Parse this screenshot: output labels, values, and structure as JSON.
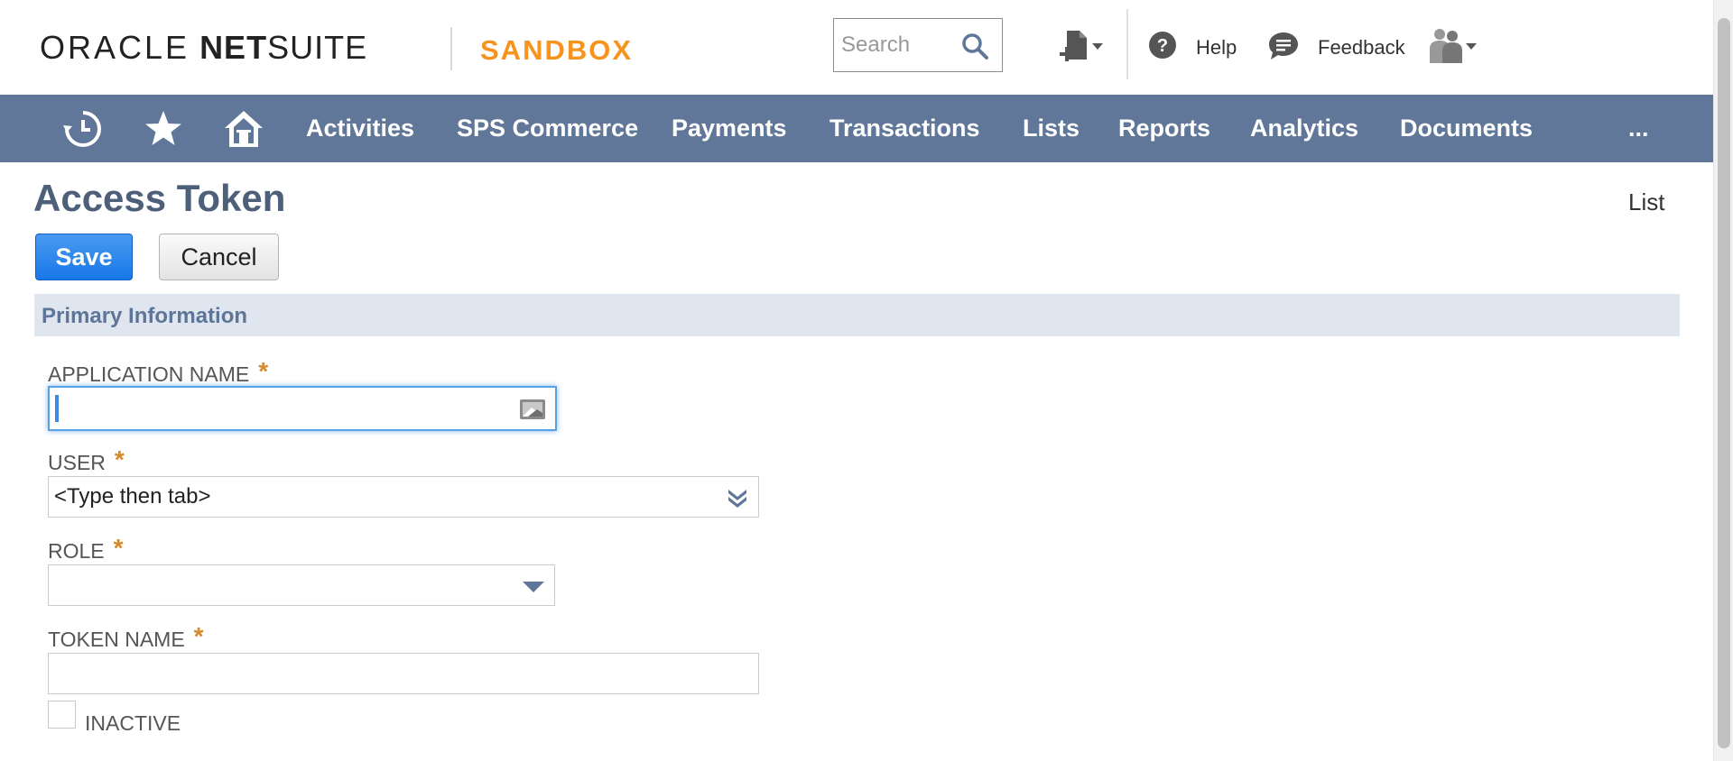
{
  "header": {
    "logo": {
      "oracle": "ORACLE",
      "net": "NET",
      "suite": "SUITE"
    },
    "environment_badge": "SANDBOX",
    "search": {
      "placeholder": "Search",
      "value": ""
    },
    "help_label": "Help",
    "feedback_label": "Feedback"
  },
  "nav": {
    "items": [
      "Activities",
      "SPS Commerce",
      "Payments",
      "Transactions",
      "Lists",
      "Reports",
      "Analytics",
      "Documents",
      "..."
    ],
    "icons": [
      "recent-records-icon",
      "star-icon",
      "home-icon"
    ]
  },
  "page": {
    "title": "Access Token",
    "list_link": "List",
    "save_label": "Save",
    "cancel_label": "Cancel"
  },
  "section": {
    "title": "Primary Information"
  },
  "form": {
    "application_name": {
      "label": "APPLICATION NAME",
      "required": "*",
      "value": ""
    },
    "user": {
      "label": "USER",
      "required": "*",
      "value": "<Type then tab>"
    },
    "role": {
      "label": "ROLE",
      "required": "*",
      "value": ""
    },
    "token_name": {
      "label": "TOKEN NAME",
      "required": "*",
      "value": ""
    },
    "inactive": {
      "label": "INACTIVE",
      "checked": false
    }
  },
  "colors": {
    "nav_bg": "#607799",
    "sandbox": "#f7941d",
    "save_button": "#1877e8",
    "section_bg": "#e0e6ef",
    "title": "#4d5f79",
    "required": "#d68a2c"
  }
}
